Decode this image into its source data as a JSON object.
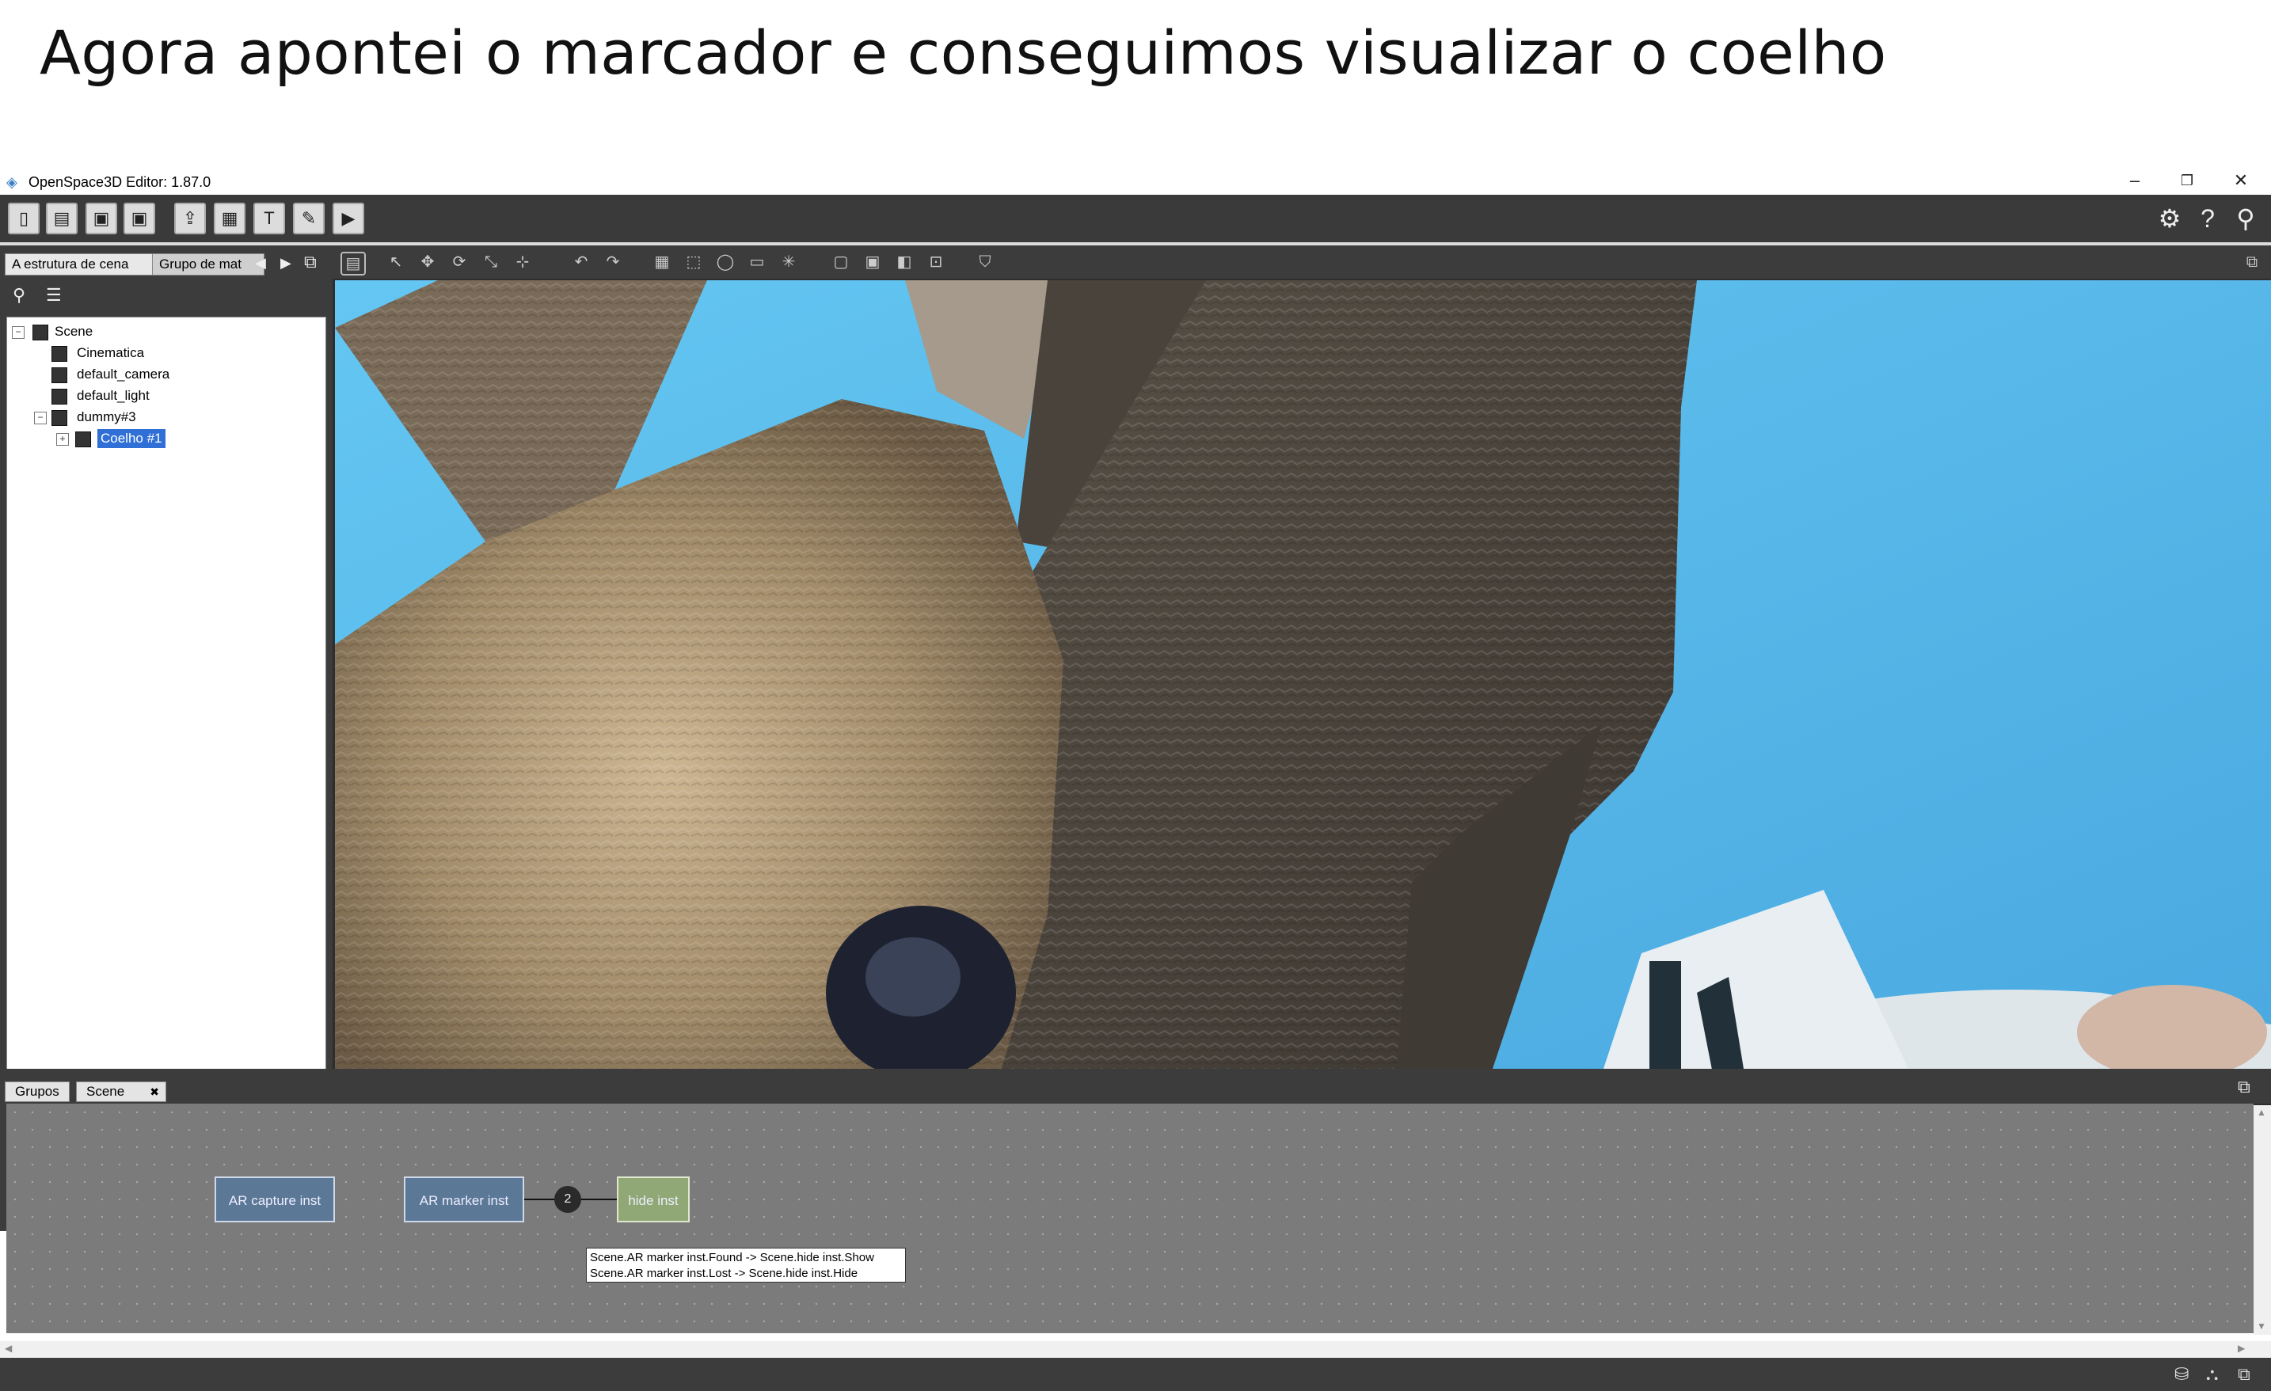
{
  "slide": {
    "title": "Agora apontei o marcador e conseguimos visualizar o coelho"
  },
  "app": {
    "title": "OpenSpace3D Editor: 1.87.0"
  },
  "window_controls": {
    "minimize": "–",
    "restore": "❐",
    "close": "✕"
  },
  "left_panel": {
    "tabs": [
      "A estrutura de cena",
      "Grupo de mat"
    ],
    "tree": [
      {
        "label": "Scene",
        "icon": "scene-icon",
        "expander": "⊟"
      },
      {
        "label": "Cinematica",
        "icon": "camera-icon"
      },
      {
        "label": "default_camera",
        "icon": "camera-icon"
      },
      {
        "label": "default_light",
        "icon": "light-icon"
      },
      {
        "label": "dummy#3",
        "icon": "node-icon",
        "expander": "⊟"
      },
      {
        "label": "Coelho #1",
        "icon": "mesh-icon",
        "expander": "⊞",
        "selected": true
      }
    ]
  },
  "graph_panel": {
    "tabs": [
      "Grupos",
      "Scene"
    ],
    "tab_close": "✖",
    "nodes": [
      {
        "label": "AR capture inst",
        "color": "#5b7897"
      },
      {
        "label": "AR marker inst",
        "color": "#5b7897"
      },
      {
        "label": "hide inst",
        "color": "#8fa876"
      }
    ],
    "link_count": "2",
    "tooltip": [
      "Scene.AR marker inst.Found -> Scene.hide inst.Show",
      "Scene.AR marker inst.Lost -> Scene.hide inst.Hide"
    ]
  },
  "colors": {
    "sky": "#5fc1ee",
    "selection": "#2f6fd6"
  }
}
